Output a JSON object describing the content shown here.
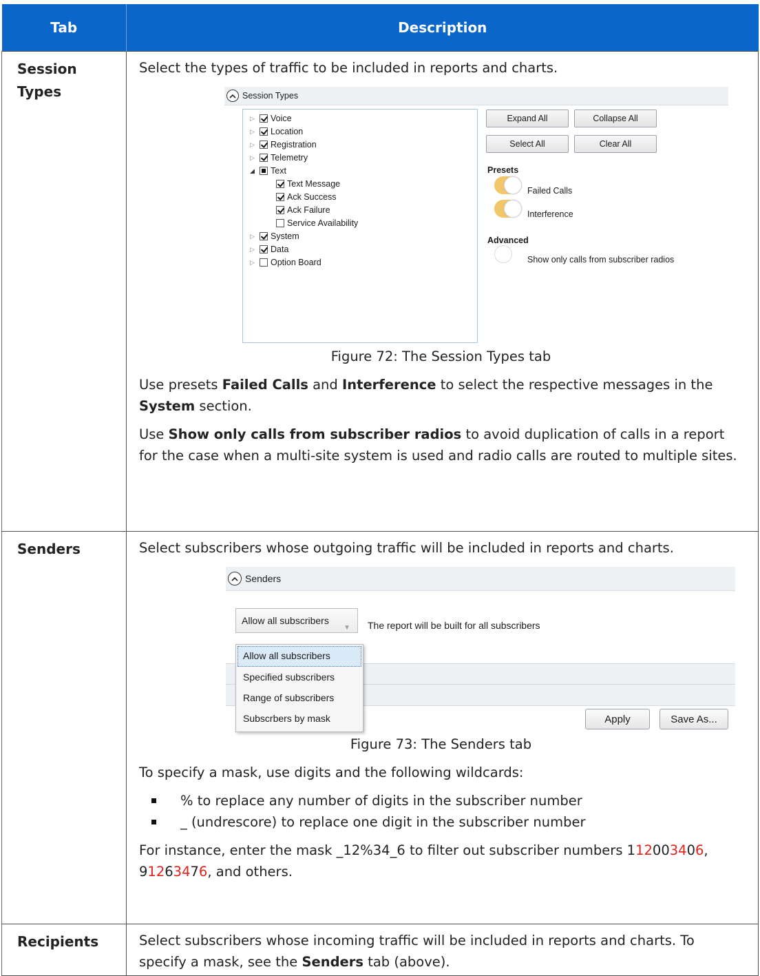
{
  "table": {
    "headers": [
      "Tab",
      "Description"
    ]
  },
  "rows": {
    "session_types": {
      "tab": "Session Types",
      "intro": "Select the types of traffic to be included in reports and charts.",
      "caption": "Figure 72: The Session Types tab",
      "p1": {
        "a": "Use presets ",
        "b1": "Failed Calls",
        "c": " and ",
        "b2": "Interference",
        "d": " to select the respective messages in the ",
        "b3": "System",
        "e": " section."
      },
      "p2": {
        "a": "Use ",
        "b1": "Show only calls from subscriber radios",
        "c": " to avoid duplication of calls in a report for the case when a multi-site system is used and radio calls are routed to multiple sites."
      }
    },
    "senders": {
      "tab": "Senders",
      "intro": "Select subscribers whose outgoing traffic will be included in reports and charts.",
      "caption": "Figure 73: The Senders tab",
      "mask_intro": "To specify a mask, use digits and the following wildcards:",
      "bullets": [
        "% to replace any number of digits in the subscriber number",
        "_ (undrescore) to replace one digit in the subscriber number"
      ],
      "example": {
        "a": "For instance, enter the mask _12%34_6 to filter out subscriber numbers 1",
        "n1_red1": "12",
        "n1_mid": "00",
        "n1_red2": "34",
        "n1_mid2": "0",
        "n1_red3": "6",
        "sep": ", 9",
        "n2_red1": "12",
        "n2_mid": "6",
        "n2_red2": "34",
        "n2_mid2": "7",
        "n2_red3": "6",
        "end": ", and others."
      }
    },
    "recipients": {
      "tab": "Recipients",
      "a": "Select subscribers whose incoming traffic will be included in reports and charts. To specify a mask, see the ",
      "b": "Senders",
      "c": " tab (above)."
    }
  },
  "shot1": {
    "panel_title": "Session Types",
    "tree": [
      {
        "label": "Voice",
        "state": "on",
        "level": 0,
        "arrow": "right"
      },
      {
        "label": "Location",
        "state": "on",
        "level": 0,
        "arrow": "right"
      },
      {
        "label": "Registration",
        "state": "on",
        "level": 0,
        "arrow": "right"
      },
      {
        "label": "Telemetry",
        "state": "on",
        "level": 0,
        "arrow": "right"
      },
      {
        "label": "Text",
        "state": "part",
        "level": 0,
        "arrow": "down"
      },
      {
        "label": "Text Message",
        "state": "on",
        "level": 1,
        "arrow": ""
      },
      {
        "label": "Ack Success",
        "state": "on",
        "level": 1,
        "arrow": ""
      },
      {
        "label": "Ack Failure",
        "state": "on",
        "level": 1,
        "arrow": ""
      },
      {
        "label": "Service Availability",
        "state": "off",
        "level": 1,
        "arrow": ""
      },
      {
        "label": "System",
        "state": "on",
        "level": 0,
        "arrow": "right"
      },
      {
        "label": "Data",
        "state": "on",
        "level": 0,
        "arrow": "right"
      },
      {
        "label": "Option Board",
        "state": "off",
        "level": 0,
        "arrow": "right"
      }
    ],
    "buttons": {
      "expand_all": "Expand All",
      "collapse_all": "Collapse All",
      "select_all": "Select All",
      "clear_all": "Clear All"
    },
    "presets_label": "Presets",
    "preset_failed_calls": "Failed Calls",
    "preset_interference": "Interference",
    "advanced_label": "Advanced",
    "advanced_option": "Show only calls from subscriber radios",
    "toggle_on_color": "#f2c76a"
  },
  "shot2": {
    "panel_title": "Senders",
    "dropdown_value": "Allow all subscribers",
    "hint": "The report will be built for all subscribers",
    "options": [
      "Allow all subscribers",
      "Specified subscribers",
      "Range of subscribers",
      "Subscrbers by mask"
    ],
    "apply": "Apply",
    "save_as": "Save As..."
  }
}
